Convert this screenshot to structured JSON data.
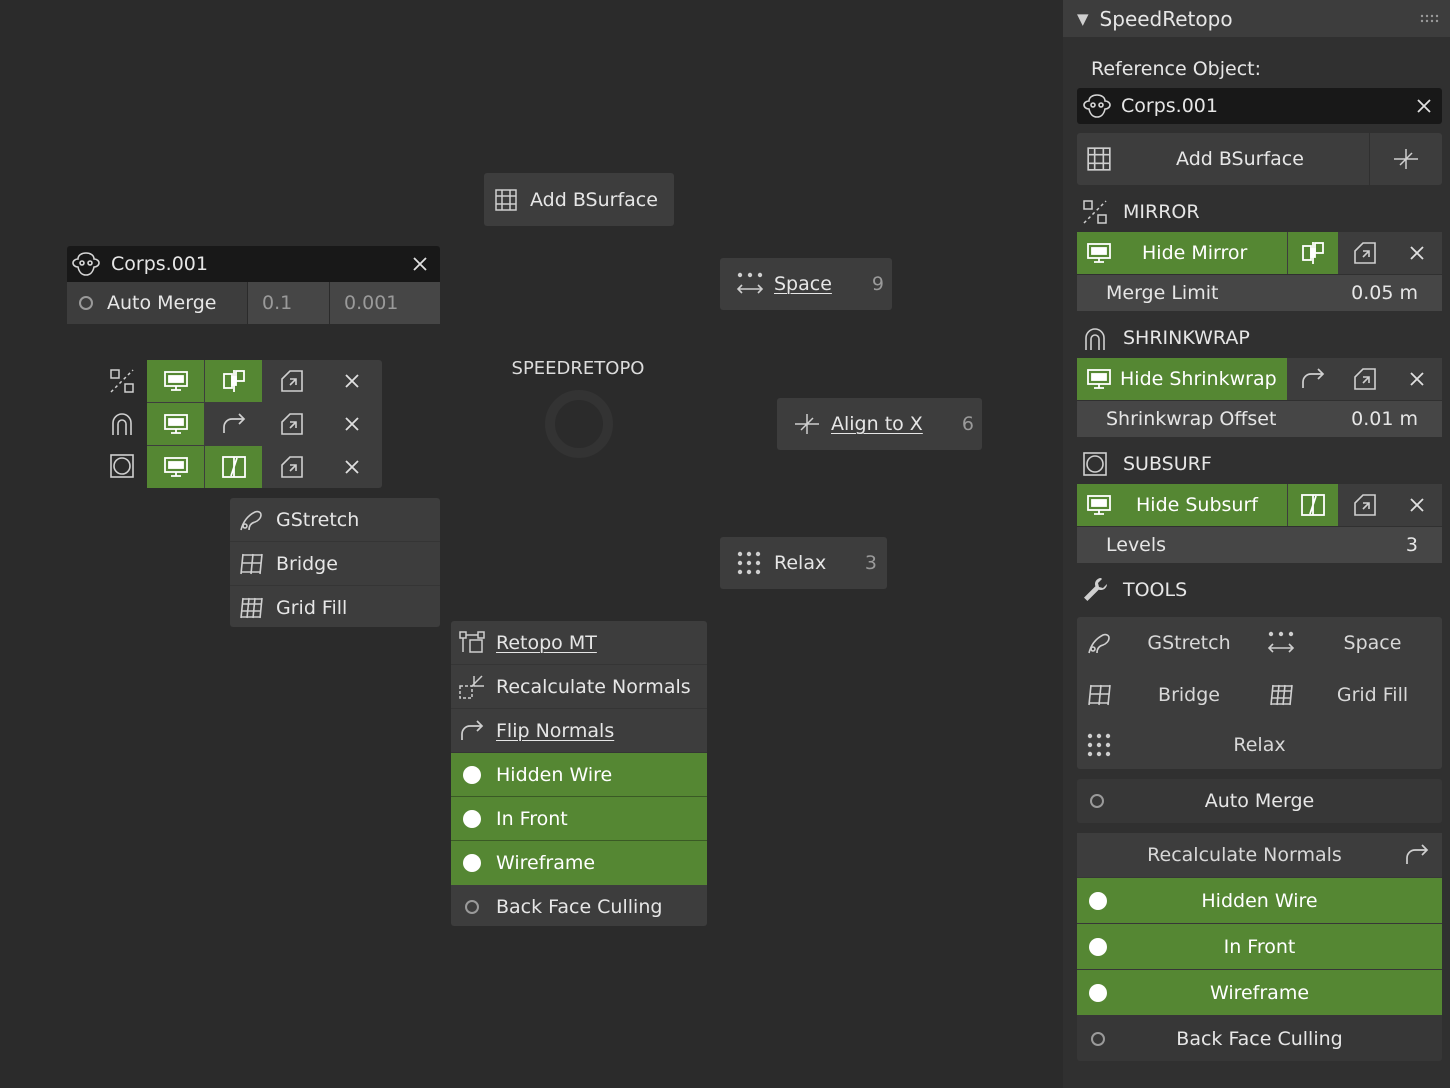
{
  "pie": {
    "title": "SPEEDRETOPO",
    "add_bsurface": "Add BSurface",
    "space": {
      "label": "Space",
      "count": "9"
    },
    "align": {
      "label": "Align to X",
      "count": "6"
    },
    "relax": {
      "label": "Relax",
      "count": "3"
    },
    "reference": {
      "name": "Corps.001"
    },
    "automerge": {
      "label": "Auto Merge",
      "value1": "0.1",
      "value2": "0.001"
    },
    "tools_list": [
      "GStretch",
      "Bridge",
      "Grid Fill"
    ],
    "normals_menu": {
      "retopo_mt": "Retopo MT",
      "recalculate": "Recalculate Normals",
      "flip": "Flip Normals",
      "hidden_wire": "Hidden Wire",
      "in_front": "In Front",
      "wireframe": "Wireframe",
      "backface": "Back Face Culling"
    }
  },
  "panel": {
    "title": "SpeedRetopo",
    "reference_label": "Reference Object:",
    "reference_value": "Corps.001",
    "add_bsurface": "Add BSurface",
    "mirror": {
      "header": "MIRROR",
      "hide": "Hide Mirror",
      "prop": "Merge Limit",
      "value": "0.05 m"
    },
    "shrinkwrap": {
      "header": "SHRINKWRAP",
      "hide": "Hide Shrinkwrap",
      "prop": "Shrinkwrap Offset",
      "value": "0.01 m"
    },
    "subsurf": {
      "header": "SUBSURF",
      "hide": "Hide Subsurf",
      "prop": "Levels",
      "value": "3"
    },
    "tools": {
      "header": "TOOLS",
      "gstretch": "GStretch",
      "space": "Space",
      "bridge": "Bridge",
      "gridfill": "Grid Fill",
      "relax": "Relax"
    },
    "auto_merge": "Auto Merge",
    "recalculate": "Recalculate Normals",
    "hidden_wire": "Hidden Wire",
    "in_front": "In Front",
    "wireframe": "Wireframe",
    "backface": "Back Face Culling"
  },
  "colors": {
    "active_green": "#558733",
    "button": "#3d3d3d",
    "background": "#2b2b2b"
  }
}
